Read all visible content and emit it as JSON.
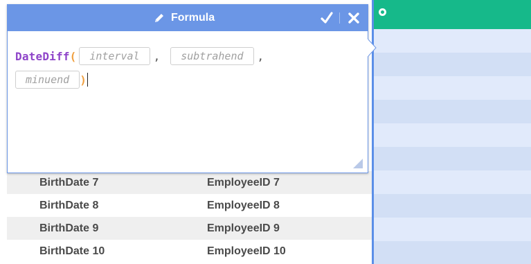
{
  "formula_panel": {
    "title": "Formula",
    "icons": {
      "title": "pencil-icon",
      "confirm": "check-icon",
      "cancel": "close-icon",
      "resize": "resize-grip-icon"
    },
    "expression": {
      "function_name": "DateDiff",
      "open_paren": "(",
      "close_paren": ")",
      "separator": ",",
      "params": [
        "interval",
        "subtrahend",
        "minuend"
      ]
    }
  },
  "table": {
    "rows": [
      {
        "birth_date": "BirthDate 7",
        "employee_id": "EmployeeID 7"
      },
      {
        "birth_date": "BirthDate 8",
        "employee_id": "EmployeeID 8"
      },
      {
        "birth_date": "BirthDate 9",
        "employee_id": "EmployeeID 9"
      },
      {
        "birth_date": "BirthDate 10",
        "employee_id": "EmployeeID 10"
      }
    ]
  },
  "selected_column": {
    "header_icon": "circle-icon"
  },
  "colors": {
    "header_blue": "#6b96e6",
    "column_header_green": "#16b98a",
    "function_purple": "#8e44c9",
    "paren_orange": "#f0a040"
  }
}
